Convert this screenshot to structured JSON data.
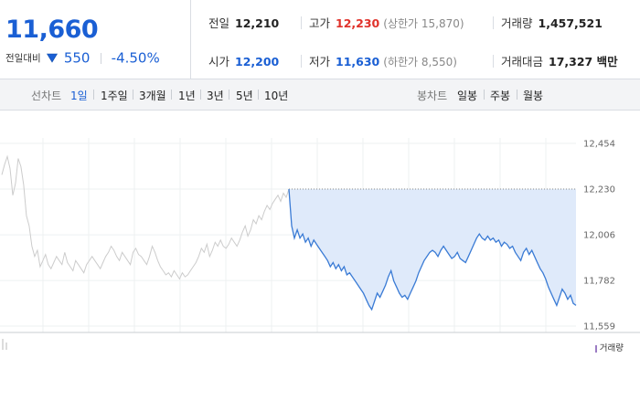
{
  "price": {
    "current": "11,660",
    "change_label": "전일대비",
    "change_icon": "down-triangle-icon",
    "change_amount": "550",
    "change_rate": "-4.50%",
    "color": "#1a5fd4"
  },
  "stats": {
    "prev_close": {
      "label": "전일",
      "value": "12,210"
    },
    "high": {
      "label": "고가",
      "value": "12,230",
      "sub": "(상한가 15,870)"
    },
    "volume": {
      "label": "거래량",
      "value": "1,457,521"
    },
    "open": {
      "label": "시가",
      "value": "12,200"
    },
    "low": {
      "label": "저가",
      "value": "11,630",
      "sub": "(하한가 8,550)"
    },
    "trade_value": {
      "label": "거래대금",
      "value": "17,327 백만"
    },
    "up_color": "#e0322b",
    "down_color": "#1a5fd4"
  },
  "line_chart": {
    "label": "선차트",
    "periods": [
      "1일",
      "1주일",
      "3개월",
      "1년",
      "3년",
      "5년",
      "10년"
    ],
    "active": "1일"
  },
  "candle_chart": {
    "label": "봉차트",
    "periods": [
      "일봉",
      "주봉",
      "월봉"
    ]
  },
  "chart_data": {
    "type": "line",
    "title": "",
    "xlabel": "",
    "ylabel": "",
    "ylim": [
      11559,
      12454
    ],
    "y_ticks": [
      "12,454",
      "12,230",
      "12,006",
      "11,782",
      "11,559"
    ],
    "reference_value": 12230,
    "series": [
      {
        "color": "#cccccc",
        "values": [
          12300,
          12350,
          12390,
          12330,
          12200,
          12260,
          12380,
          12340,
          12250,
          12100,
          12050,
          11950,
          11900,
          11930,
          11850,
          11880,
          11910,
          11860,
          11840,
          11870,
          11900,
          11880,
          11860,
          11920,
          11870,
          11850,
          11830,
          11880,
          11860,
          11840,
          11820,
          11860,
          11880,
          11900,
          11880,
          11860,
          11840,
          11870,
          11900,
          11920,
          11950,
          11930,
          11900,
          11880,
          11920,
          11900,
          11880,
          11860,
          11920,
          11940,
          11910,
          11900,
          11880,
          11860,
          11900,
          11950,
          11920,
          11880,
          11850,
          11830,
          11810,
          11820,
          11800,
          11830,
          11810,
          11790,
          11820,
          11800,
          11810,
          11830,
          11850,
          11870,
          11900,
          11940,
          11920,
          11960,
          11900,
          11930,
          11970,
          11950,
          11980,
          11950,
          11940,
          11960,
          11990,
          11970,
          11950,
          11980,
          12020,
          12050,
          12000,
          12030,
          12080,
          12060,
          12100,
          12080,
          12120,
          12150,
          12130,
          12160,
          12180,
          12200,
          12170,
          12210,
          12190,
          12230
        ]
      },
      {
        "color": "#3a7bd5",
        "values": [
          12230,
          12050,
          11990,
          12030,
          11990,
          12010,
          11970,
          11990,
          11950,
          11980,
          11960,
          11940,
          11920,
          11900,
          11880,
          11850,
          11870,
          11840,
          11860,
          11830,
          11850,
          11810,
          11820,
          11800,
          11780,
          11760,
          11740,
          11720,
          11690,
          11660,
          11640,
          11680,
          11720,
          11700,
          11730,
          11760,
          11800,
          11830,
          11780,
          11750,
          11720,
          11700,
          11710,
          11690,
          11720,
          11750,
          11780,
          11820,
          11850,
          11880,
          11900,
          11920,
          11930,
          11920,
          11900,
          11930,
          11950,
          11930,
          11910,
          11890,
          11900,
          11920,
          11890,
          11880,
          11870,
          11900,
          11930,
          11960,
          11990,
          12010,
          11990,
          11980,
          12000,
          11980,
          11990,
          11970,
          11980,
          11950,
          11970,
          11960,
          11940,
          11950,
          11920,
          11900,
          11880,
          11920,
          11940,
          11910,
          11930,
          11900,
          11870,
          11840,
          11820,
          11790,
          11750,
          11720,
          11690,
          11660,
          11700,
          11740,
          11720,
          11690,
          11710,
          11670,
          11660
        ]
      }
    ]
  },
  "volume_legend": "거래량"
}
